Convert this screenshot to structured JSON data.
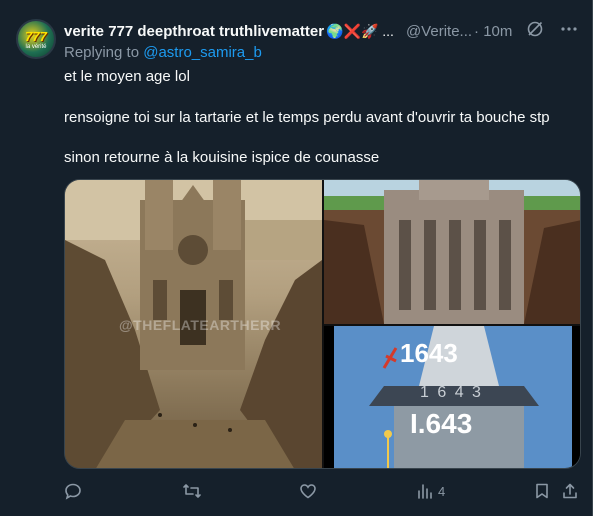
{
  "author": {
    "avatar_text": "777",
    "avatar_sub": "la vérité",
    "display_name": "verite 777 deepthroat truthlivematter",
    "emoji": "🌍❌🚀 ...",
    "handle": "@Verite...",
    "time": "· 10m"
  },
  "reply": {
    "prefix": "Replying to ",
    "mention": "@astro_samira_b"
  },
  "body": {
    "line1": "et le moyen age lol",
    "line2": "rensoigne toi sur la tartarie et le temps perdu avant d'ouvrir ta bouche stp",
    "line3": "sinon retourne à la kouisine ispice de counasse"
  },
  "media": {
    "watermark": "@THEFLATEARTHERR",
    "year_crossed": "1643",
    "year_engraved": "1 6 4 3",
    "year_new": "I.643"
  },
  "actions": {
    "views_count": "4"
  },
  "colors": {
    "background": "#15202b",
    "text": "#f7f9f9",
    "muted": "#8b98a5",
    "accent": "#1d9bf0"
  },
  "icons": [
    "grok-icon",
    "more-icon",
    "reply-icon",
    "retweet-icon",
    "like-icon",
    "views-icon",
    "bookmark-icon",
    "share-icon"
  ]
}
